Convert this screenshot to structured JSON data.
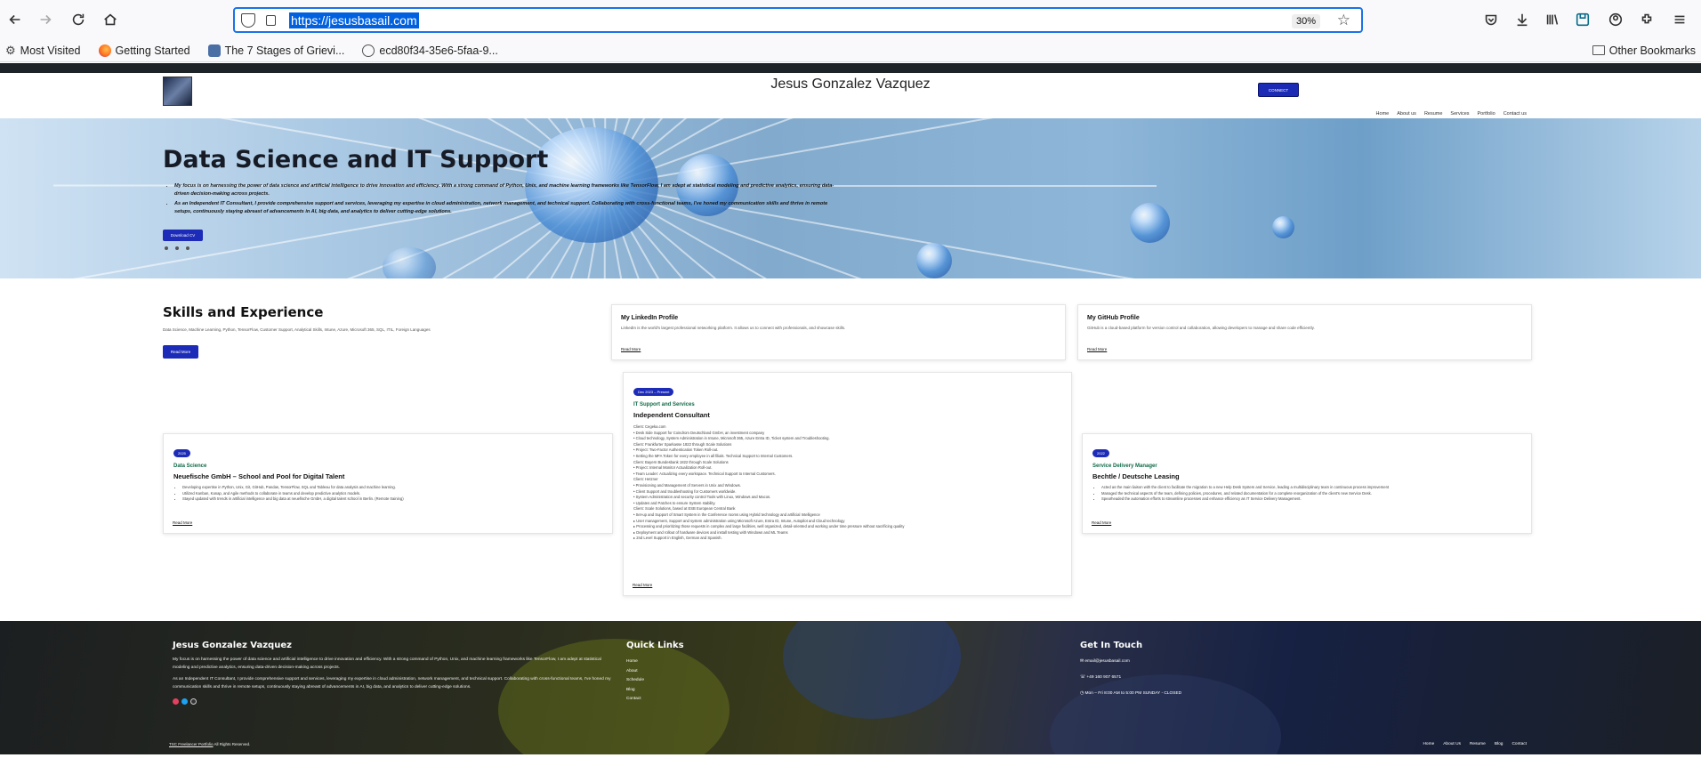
{
  "browser": {
    "url": "https://jesusbasail.com",
    "zoom": "30%",
    "bookmarks": [
      {
        "label": "Most Visited",
        "icon": "gear-icon"
      },
      {
        "label": "Getting Started",
        "icon": "firefox-icon"
      },
      {
        "label": "The 7 Stages of Grievi...",
        "icon": "page-icon"
      },
      {
        "label": "ecd80f34-35e6-5faa-9...",
        "icon": "globe-icon"
      }
    ],
    "other_bookmarks": "Other Bookmarks"
  },
  "site": {
    "name": "Jesus Gonzalez Vazquez",
    "connect_label": "CONNECT",
    "nav": [
      "Home",
      "About us",
      "Resume",
      "Services",
      "Portfolio",
      "Contact us"
    ]
  },
  "hero": {
    "title": "Data Science and IT Support",
    "bullets": [
      "My focus is on harnessing the power of data science and artificial intelligence to drive innovation and efficiency. With a strong command of Python, Unix, and machine learning frameworks like TensorFlow, I am adept at statistical modeling and predictive analytics, ensuring data-driven decision-making across projects.",
      "As an Independent IT Consultant, I provide comprehensive support and services, leveraging my expertise in cloud administration, network management, and technical support. Collaborating with cross-functional teams, I've honed my communication skills and thrive in remote setups, continuously staying abreast of advancements in AI, big data, and analytics to deliver cutting-edge solutions."
    ],
    "cv_label": "Download CV"
  },
  "skills": {
    "title": "Skills and Experience",
    "desc": "Data Science, Machine Learning, Python, TensorFlow, Customer Support, Analytical Skills, Intune, Azure, Microsoft 365, SQL, ITIL, Foreign Languages",
    "button": "Read More"
  },
  "profiles": [
    {
      "title": "My LinkedIn Profile",
      "desc": "LinkedIn is the world's largest professional networking platform. It allows us to connect with professionals, and showcase skills.",
      "link": "Read More"
    },
    {
      "title": "My GitHub Profile",
      "desc": "GitHub is a cloud-based platform for version control and collaboration, allowing developers to manage and share code efficiently.",
      "link": "Read More"
    }
  ],
  "experience": {
    "left": {
      "badge": "2025",
      "role": "Data Science",
      "company": "Neuefische GmbH – School and Pool for Digital Talent",
      "items": [
        "Developing expertise in Python, Unix, Git, GitHub, Pandas, TensorFlow, SQL and Tableau for data analysis and machine learning.",
        "Utilized Kanban, Kanap, and Agile methods to collaborate in teams and develop predictive analytics models.",
        "Stayed updated with trends in artificial intelligence and big data at neuefische GmbH, a digital talent school in Berlin. (Remote training)"
      ],
      "link": "Read More"
    },
    "center": {
      "badge": "Dec 2023 – Present",
      "role": "IT Support and Services",
      "company": "Independent Consultant",
      "lines": [
        "Client: Cegeka.com",
        "• Desk Side Support for Coindrom Deutschland GmbH, an investment company",
        "• Cloud technology, System Administration in Intune, Microsoft 365, Azure Entra ID, Ticket system and Troubleshooting.",
        "Client: Frankfurter Sparkasse 1822 through Scale Solutions",
        "• Project: Two-Factor Authentication Token Roll-out.",
        "• Setting the MFA Token for every employee in all filials. Technical Support to Internal Customers.",
        "Client: Bayern Bundesbank 1822 through Scale Solutions",
        "• Project: Internal Monitor Actualization Roll-out.",
        "• Team Leader: Actualizing every workspace. Technical Support to Internal Customers.",
        "Client: Hetzner",
        "• Provisioning and Management of Servers in Unix and Windows.",
        "• Client Support and troubleshooting for Customers worldwide.",
        "• System Administration and security control Tools with Linux, Windows and Macos.",
        "• Updates and Patches to ensure System stability.",
        "Client: Scale Solutions, based at ESB European Central Bank",
        "• Set-up and Support of Smart System in the Conference rooms using Hybrid technology and artificial Intelligence",
        "  ▸ User management, Support and system administration using Microsoft Azure, Entra ID, Intune, Autopilot and Cloud technology",
        "  ▸ Processing and prioritizing those requests in complex and large facilities, well organized, detail-oriented and working under time pressure without sacrificing quality",
        "  ▸ Deployment and rollout of hardware devices and install testing with Windows and ML Teams",
        "  ▸ 2nd Level Support in English, German and Spanish."
      ],
      "link": "Read More"
    },
    "right": {
      "badge": "2022",
      "role": "Service Delivery Manager",
      "company": "Bechtle / Deutsche Leasing",
      "items": [
        "Acted as the main liaison with the client to facilitate the migration to a new Help Desk System and Service, leading a multidisciplinary team in continuous process improvement",
        "Managed the technical aspects of the team, defining policies, procedures, and related documentation for a complete reorganization of the client's new Service Desk.",
        "Spearheaded the automation efforts to streamline processes and enhance efficiency as IT Service Delivery Management."
      ],
      "link": "Read More"
    }
  },
  "footer": {
    "about_title": "Jesus Gonzalez Vazquez",
    "about_p1": "My focus is on harnessing the power of data science and artificial intelligence to drive innovation and efficiency. With a strong command of Python, Unix, and machine learning frameworks like TensorFlow, I am adept at statistical modeling and predictive analytics, ensuring data-driven decision-making across projects.",
    "about_p2": "As an Independent IT Consultant, I provide comprehensive support and services, leveraging my expertise in cloud administration, network management, and technical support. Collaborating with cross-functional teams, I've honed my communication skills and thrive in remote setups, continuously staying abreast of advancements in AI, big data, and analytics to deliver cutting-edge solutions.",
    "links_title": "Quick Links",
    "links": [
      "Home",
      "About",
      "Schedule",
      "Blog",
      "Contact"
    ],
    "contact_title": "Get In Touch",
    "email": "email@jesusbasail.com",
    "phone": "+49 160 907 6571",
    "hours": "Mon – Fri 8:00 AM to 5:00 PM SUNDAY - CLOSED",
    "copyright_link": "TSC Freelancer Portfolio",
    "copyright_rest": " All Rights Reserved.",
    "nav": [
      "Home",
      "About Us",
      "Resume",
      "Blog",
      "Contact"
    ],
    "social_colors": [
      "#e4405f",
      "#1da1f2",
      "#333333"
    ]
  }
}
